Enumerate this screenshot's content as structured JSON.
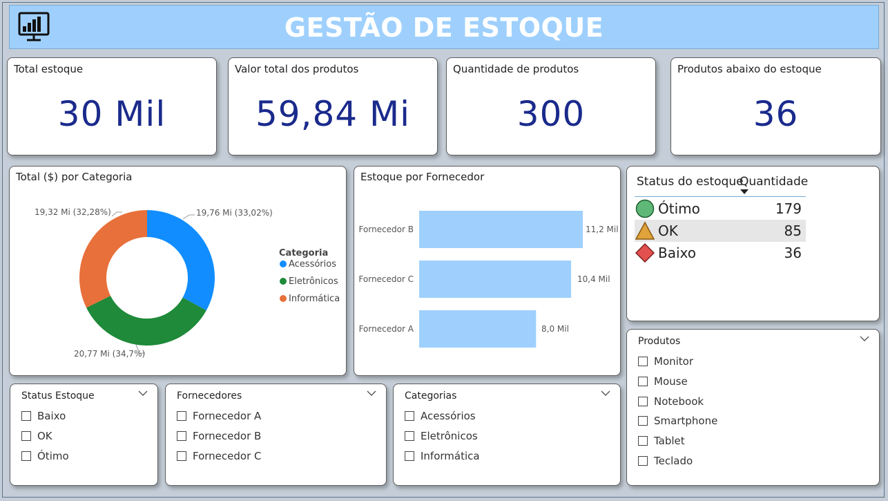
{
  "header": {
    "title": "GESTÃO DE ESTOQUE",
    "logo_icon": "monitor-chart-icon",
    "background": "#9fd0fd"
  },
  "kpis": [
    {
      "label": "Total estoque",
      "value": "30 Mil"
    },
    {
      "label": "Valor total dos produtos",
      "value": "59,84 Mi"
    },
    {
      "label": "Quantidade de produtos",
      "value": "300"
    },
    {
      "label": "Produtos abaixo do estoque",
      "value": "36"
    }
  ],
  "donut_panel": {
    "title": "Total ($) por Categoria",
    "legend_title": "Categoria",
    "slice_labels": [
      "19,76 Mi (33,02%)",
      "20,77 Mi (34,7%)",
      "19,32 Mi (32,28%)"
    ]
  },
  "bar_panel": {
    "title": "Estoque por Fornecedor",
    "value_labels": [
      "11,2 Mil",
      "10,4 Mil",
      "8,0 Mil"
    ]
  },
  "chart_data": [
    {
      "type": "pie",
      "title": "Total ($) por Categoria",
      "categories": [
        "Acessórios",
        "Eletrônicos",
        "Informática"
      ],
      "values": [
        19.76,
        20.77,
        19.32
      ],
      "percentages": [
        33.02,
        34.7,
        32.28
      ],
      "unit": "Mi",
      "colors": [
        "#118dff",
        "#1e8a3a",
        "#e8703a"
      ],
      "legend_title": "Categoria",
      "legend_position": "right"
    },
    {
      "type": "bar",
      "orientation": "horizontal",
      "title": "Estoque por Fornecedor",
      "categories": [
        "Fornecedor B",
        "Fornecedor C",
        "Fornecedor A"
      ],
      "values": [
        11.2,
        10.4,
        8.0
      ],
      "unit": "Mil",
      "color": "#9fd0fd",
      "grid": false
    }
  ],
  "status_table": {
    "headers": {
      "status": "Status do estoque",
      "quantity": "Quantidade"
    },
    "rows": [
      {
        "icon": "green-circle-icon",
        "name": "Ótimo",
        "qty": "179"
      },
      {
        "icon": "yellow-triangle-icon",
        "name": "OK",
        "qty": "85"
      },
      {
        "icon": "red-diamond-icon",
        "name": "Baixo",
        "qty": "36"
      }
    ]
  },
  "slicers": {
    "status": {
      "title": "Status Estoque",
      "options": [
        "Baixo",
        "OK",
        "Ótimo"
      ]
    },
    "fornecedores": {
      "title": "Fornecedores",
      "options": [
        "Fornecedor A",
        "Fornecedor B",
        "Fornecedor C"
      ]
    },
    "categorias": {
      "title": "Categorias",
      "options": [
        "Acessórios",
        "Eletrônicos",
        "Informática"
      ]
    },
    "produtos": {
      "title": "Produtos",
      "options": [
        "Monitor",
        "Mouse",
        "Notebook",
        "Smartphone",
        "Tablet",
        "Teclado"
      ]
    }
  }
}
